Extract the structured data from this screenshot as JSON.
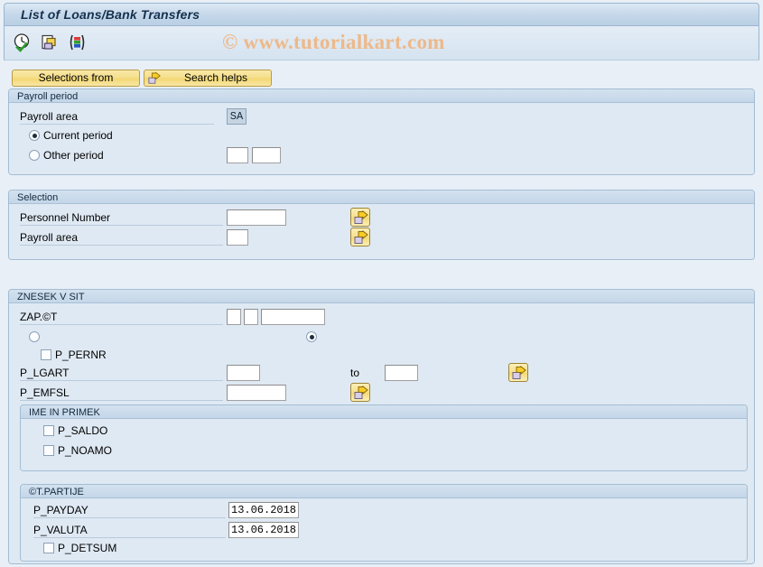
{
  "window": {
    "title": "List of Loans/Bank Transfers"
  },
  "watermark": {
    "text": "© www.tutorialkart.com"
  },
  "toolbar": {
    "icons": [
      {
        "name": "execute-in-background-icon",
        "title": "Execute in background"
      },
      {
        "name": "multiple-selection-icon",
        "title": "Multiple selection"
      },
      {
        "name": "variant-icon",
        "title": "Get variant"
      }
    ]
  },
  "buttons": {
    "selections_from": "Selections from",
    "search_helps": "Search helps"
  },
  "payroll_period": {
    "title": "Payroll period",
    "payroll_area_label": "Payroll area",
    "payroll_area_value": "SA",
    "current_period_label": "Current period",
    "other_period_label": "Other period",
    "current_period_selected": true,
    "other_period_value_1": "",
    "other_period_value_2": ""
  },
  "selection": {
    "title": "Selection",
    "personnel_number_label": "Personnel Number",
    "personnel_number_value": "",
    "payroll_area_label": "Payroll area",
    "payroll_area_value": ""
  },
  "znesek": {
    "title": "ZNESEK V SIT",
    "zap_label": "ZAP.©T",
    "zap_value_1": "",
    "zap_value_2": "",
    "zap_value_3": "",
    "radio_left_selected": false,
    "radio_right_selected": true,
    "p_pernr_label": "P_PERNR",
    "p_pernr_checked": false,
    "p_lgart_label": "P_LGART",
    "p_lgart_from": "",
    "to_label": "to",
    "p_lgart_to": "",
    "p_emfsl_label": "P_EMFSL",
    "p_emfsl_value": "",
    "ime_in_primek": {
      "title": "IME IN PRIMEK",
      "p_saldo_label": "P_SALDO",
      "p_saldo_checked": false,
      "p_noamo_label": "P_NOAMO",
      "p_noamo_checked": false
    },
    "ct_partije": {
      "title": "©T.PARTIJE",
      "p_payday_label": "P_PAYDAY",
      "p_payday_value": "13.06.2018",
      "p_valuta_label": "P_VALUTA",
      "p_valuta_value": "13.06.2018",
      "p_detsum_label": "P_DETSUM",
      "p_detsum_checked": false
    }
  },
  "colors": {
    "accent": "#b9cfe4",
    "button": "#f5de8b",
    "panel": "#dfe9f3",
    "watermark": "#edb98a"
  }
}
